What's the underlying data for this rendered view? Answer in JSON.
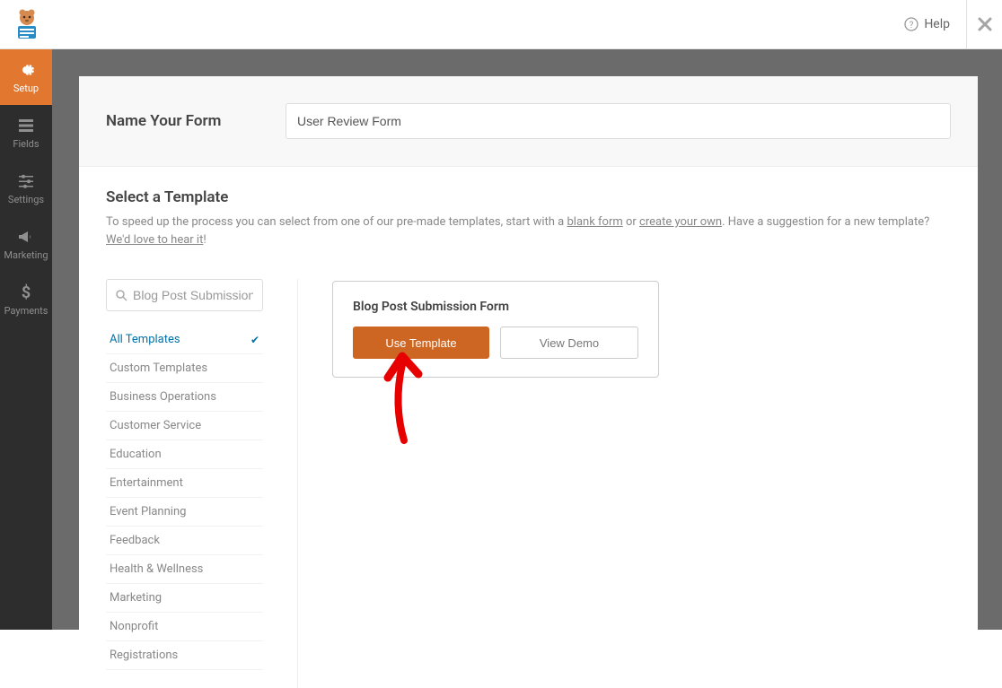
{
  "header": {
    "help_label": "Help"
  },
  "sidebar": {
    "items": [
      {
        "label": "Setup",
        "icon": "gear"
      },
      {
        "label": "Fields",
        "icon": "list"
      },
      {
        "label": "Settings",
        "icon": "sliders"
      },
      {
        "label": "Marketing",
        "icon": "bullhorn"
      },
      {
        "label": "Payments",
        "icon": "dollar"
      }
    ]
  },
  "form_name": {
    "label": "Name Your Form",
    "value": "User Review Form"
  },
  "template_section": {
    "title": "Select a Template",
    "desc_prefix": "To speed up the process you can select from one of our pre-made templates, start with a ",
    "link1": "blank form",
    "desc_mid1": " or ",
    "link2": "create your own",
    "desc_mid2": ". Have a suggestion for a new template? ",
    "link3": "We'd love to hear it",
    "desc_suffix": "!"
  },
  "search": {
    "value": "Blog Post Submission"
  },
  "categories": [
    {
      "label": "All Templates",
      "active": true
    },
    {
      "label": "Custom Templates"
    },
    {
      "label": "Business Operations"
    },
    {
      "label": "Customer Service"
    },
    {
      "label": "Education"
    },
    {
      "label": "Entertainment"
    },
    {
      "label": "Event Planning"
    },
    {
      "label": "Feedback"
    },
    {
      "label": "Health & Wellness"
    },
    {
      "label": "Marketing"
    },
    {
      "label": "Nonprofit"
    },
    {
      "label": "Registrations"
    }
  ],
  "template_card": {
    "title": "Blog Post Submission Form",
    "use_label": "Use Template",
    "demo_label": "View Demo"
  }
}
